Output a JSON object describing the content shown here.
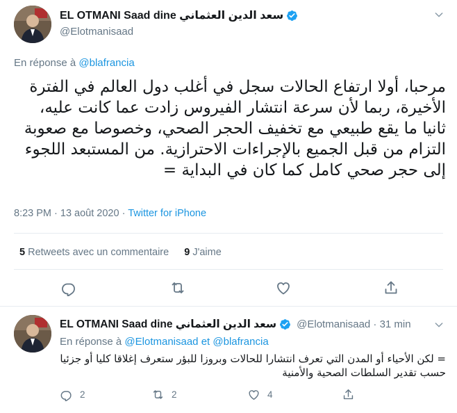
{
  "main_tweet": {
    "display_name": "EL OTMANI Saad dine سعد الدين العثماني",
    "handle": "@Elotmanisaad",
    "reply_prefix": "En réponse à",
    "reply_handle": "@blafrancia",
    "text": "مرحبا، أولا ارتفاع الحالات سجل في أغلب دول العالم في الفترة الأخيرة، ربما لأن سرعة انتشار الفيروس زادت عما كانت عليه، ثانيا ما يقع طبيعي مع تخفيف الحجر الصحي، وخصوصا مع صعوبة التزام من قبل الجميع بالإجراءات الاحترازية. من المستبعد اللجوء إلى حجر صحي كامل كما كان في البداية =",
    "time": "8:23 PM · 13 août 2020 · ",
    "source": "Twitter for iPhone",
    "retweets_count": "5",
    "retweets_label": "Retweets avec un commentaire",
    "likes_count": "9",
    "likes_label": "J'aime"
  },
  "reply_tweet": {
    "display_name": "EL OTMANI Saad dine سعد الدين العثماني",
    "handle_time": "@Elotmanisaad · 31 min",
    "reply_prefix": "En réponse à",
    "reply_handle_1": "@Elotmanisaad",
    "reply_and": "et",
    "reply_handle_2": "@blafrancia",
    "text": "= لكن الأحياء أو المدن التي تعرف انتشارا للحالات وبروزا للبؤر ستعرف إغلاقا كليا أو جزئيا حسب تقدير السلطات الصحية والأمنية",
    "replies": "2",
    "retweets": "2",
    "likes": "4"
  },
  "colors": {
    "link": "#1b95e0",
    "secondary_text": "#657786",
    "primary_text": "#14171a",
    "verified": "#1da1f2",
    "divider": "#e6ecf0"
  },
  "icons": [
    "verified-badge-icon",
    "chevron-down-icon",
    "reply-icon",
    "retweet-icon",
    "like-icon",
    "share-icon"
  ]
}
